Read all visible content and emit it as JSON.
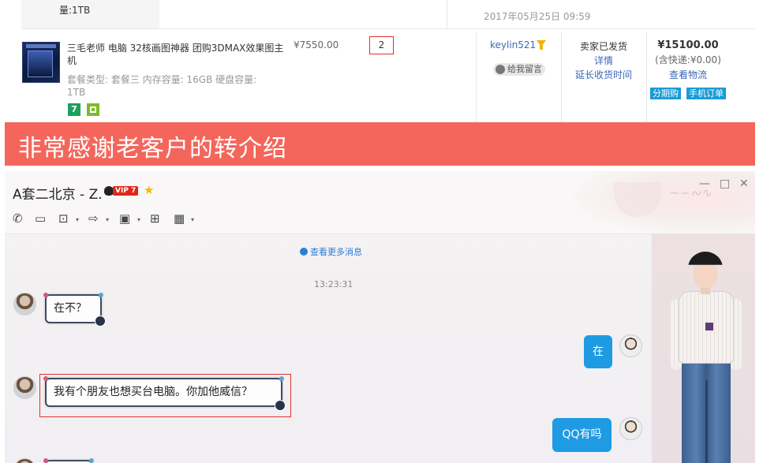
{
  "order_list": {
    "prev_row": {
      "capacity_tail": "量:1TB",
      "date": "2017年05月25日 09:59"
    },
    "row": {
      "product_title": "三毛老师 电脑 32核画图神器 团购3DMAX效果图主机",
      "product_spec": "套餐类型: 套餐三  内存容量: 16GB  硬盘容量: 1TB",
      "badge_seven": "7",
      "unit_price": "¥7550.00",
      "quantity": "2",
      "buyer_name": "keylin521",
      "message_button": "给我留言",
      "status_shipped": "卖家已发货",
      "status_details": "详情",
      "status_extend": "延长收货时间",
      "total_amount": "¥15100.00",
      "shipping_note": "(含快递:¥0.00)",
      "view_logistics": "查看物流",
      "tag_installment": "分期购",
      "tag_mobile_order": "手机订单"
    }
  },
  "banner": {
    "text": "非常感谢老客户的转介绍"
  },
  "chat_window": {
    "contact_name": "A套二北京 - Z.",
    "vip_label": "VIP 7",
    "window_controls": [
      "—",
      "□",
      "✕"
    ],
    "toolbar_icons": [
      "phone-icon",
      "video-icon",
      "screen-share-icon",
      "file-transfer-icon",
      "remote-desktop-icon",
      "add-app-icon",
      "more-apps-icon"
    ],
    "more_messages": "查看更多消息",
    "timestamp": "13:23:31",
    "messages": [
      {
        "side": "left",
        "text": "在不？"
      },
      {
        "side": "right",
        "text": "在"
      },
      {
        "side": "left",
        "text": "我有个朋友也想买台电脑。你加他威信？"
      },
      {
        "side": "right",
        "text": "QQ有吗"
      }
    ]
  },
  "colors": {
    "banner_bg": "#f4665b",
    "link_blue": "#3c68b6",
    "bubble_blue": "#1e9be3",
    "highlight_red": "#e03030",
    "vip_red": "#e1251b"
  }
}
